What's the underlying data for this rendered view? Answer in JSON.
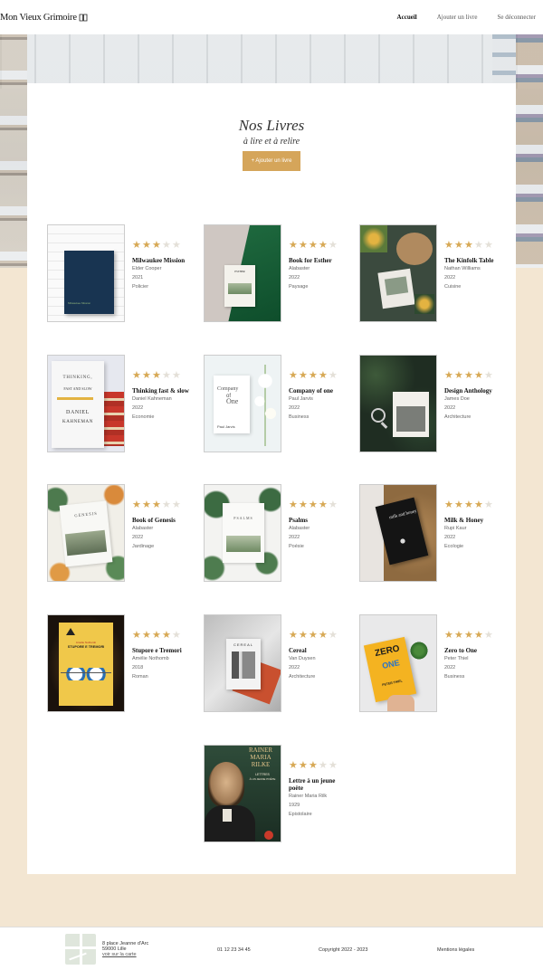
{
  "header": {
    "brand": "Mon Vieux Grimoire",
    "nav": [
      "Accueil",
      "Ajouter un livre",
      "Se déconnecter"
    ]
  },
  "page": {
    "title": "Nos Livres",
    "subtitle": "à lire et à relire",
    "add_button": "+ Ajouter un livre"
  },
  "books": [
    {
      "title": "Milwaukee Mission",
      "author": "Elder Cooper",
      "year": "2021",
      "genre": "Policier",
      "rating": 3
    },
    {
      "title": "Book for Esther",
      "author": "Alabaster",
      "year": "2022",
      "genre": "Paysage",
      "rating": 4
    },
    {
      "title": "The Kinfolk Table",
      "author": "Nathan Williams",
      "year": "2022",
      "genre": "Cuisine",
      "rating": 3
    },
    {
      "title": "Thinking fast & slow",
      "author": "Daniel Kahneman",
      "year": "2022",
      "genre": "Economie",
      "rating": 3
    },
    {
      "title": "Company of one",
      "author": "Paul Jarvis",
      "year": "2022",
      "genre": "Business",
      "rating": 4
    },
    {
      "title": "Design Anthology",
      "author": "James Doe",
      "year": "2022",
      "genre": "Architecture",
      "rating": 4
    },
    {
      "title": "Book of Genesis",
      "author": "Alabaster",
      "year": "2022",
      "genre": "Jardinage",
      "rating": 3
    },
    {
      "title": "Psalms",
      "author": "Alabaster",
      "year": "2022",
      "genre": "Poésie",
      "rating": 4
    },
    {
      "title": "Milk & Honey",
      "author": "Rupi Kaur",
      "year": "2022",
      "genre": "Ecologie",
      "rating": 4
    },
    {
      "title": "Stupore e Tremori",
      "author": "Amélie Nothomb",
      "year": "2018",
      "genre": "Roman",
      "rating": 4
    },
    {
      "title": "Cereal",
      "author": "Van Duysen",
      "year": "2022",
      "genre": "Architecture",
      "rating": 4
    },
    {
      "title": "Zero to One",
      "author": "Peter Thiel",
      "year": "2022",
      "genre": "Business",
      "rating": 4
    },
    {
      "title": "Lettre à un jeune poète",
      "author": "Rainer Maria Rilk",
      "year": "1929",
      "genre": "Epistolaire",
      "rating": 3
    }
  ],
  "covers": {
    "milwaukee": "Milwaukee Mission",
    "esther": "ESTHER",
    "thinking_1": "THINKING,",
    "thinking_2": "FAST AND SLOW",
    "thinking_3": "DANIEL",
    "thinking_4": "KAHNEMAN",
    "company_1": "Company",
    "company_2": "of",
    "company_3": "One",
    "company_4": "Paul Jarvis",
    "genesis": "GENESIS",
    "psalms": "PSALMS",
    "milk": "milk and honey",
    "stupore_1": "Amélie Nothomb",
    "stupore_2": "STUPORE E TREMORI",
    "cereal": "CEREAL",
    "zero_1": "ZERO",
    "zero_2": "ONE",
    "zero_3": "PETER THIEL",
    "rilke_1": "RAINER",
    "rilke_2": "MARIA",
    "rilke_3": "RILKE",
    "rilke_4": "LETTRES",
    "rilke_5": "À UN JEUNE POÈTE"
  },
  "footer": {
    "address_1": "8 place Jeanne d'Arc",
    "address_2": "59000 Lille",
    "map_link": "voir sur la carte",
    "phone": "01 12 23 34 45",
    "copyright": "Copyright 2022 - 2023",
    "legal": "Mentions légales"
  },
  "colors": {
    "accent": "#d5a55a",
    "star": "#d7a955",
    "page_bg": "#f3e6d2"
  }
}
